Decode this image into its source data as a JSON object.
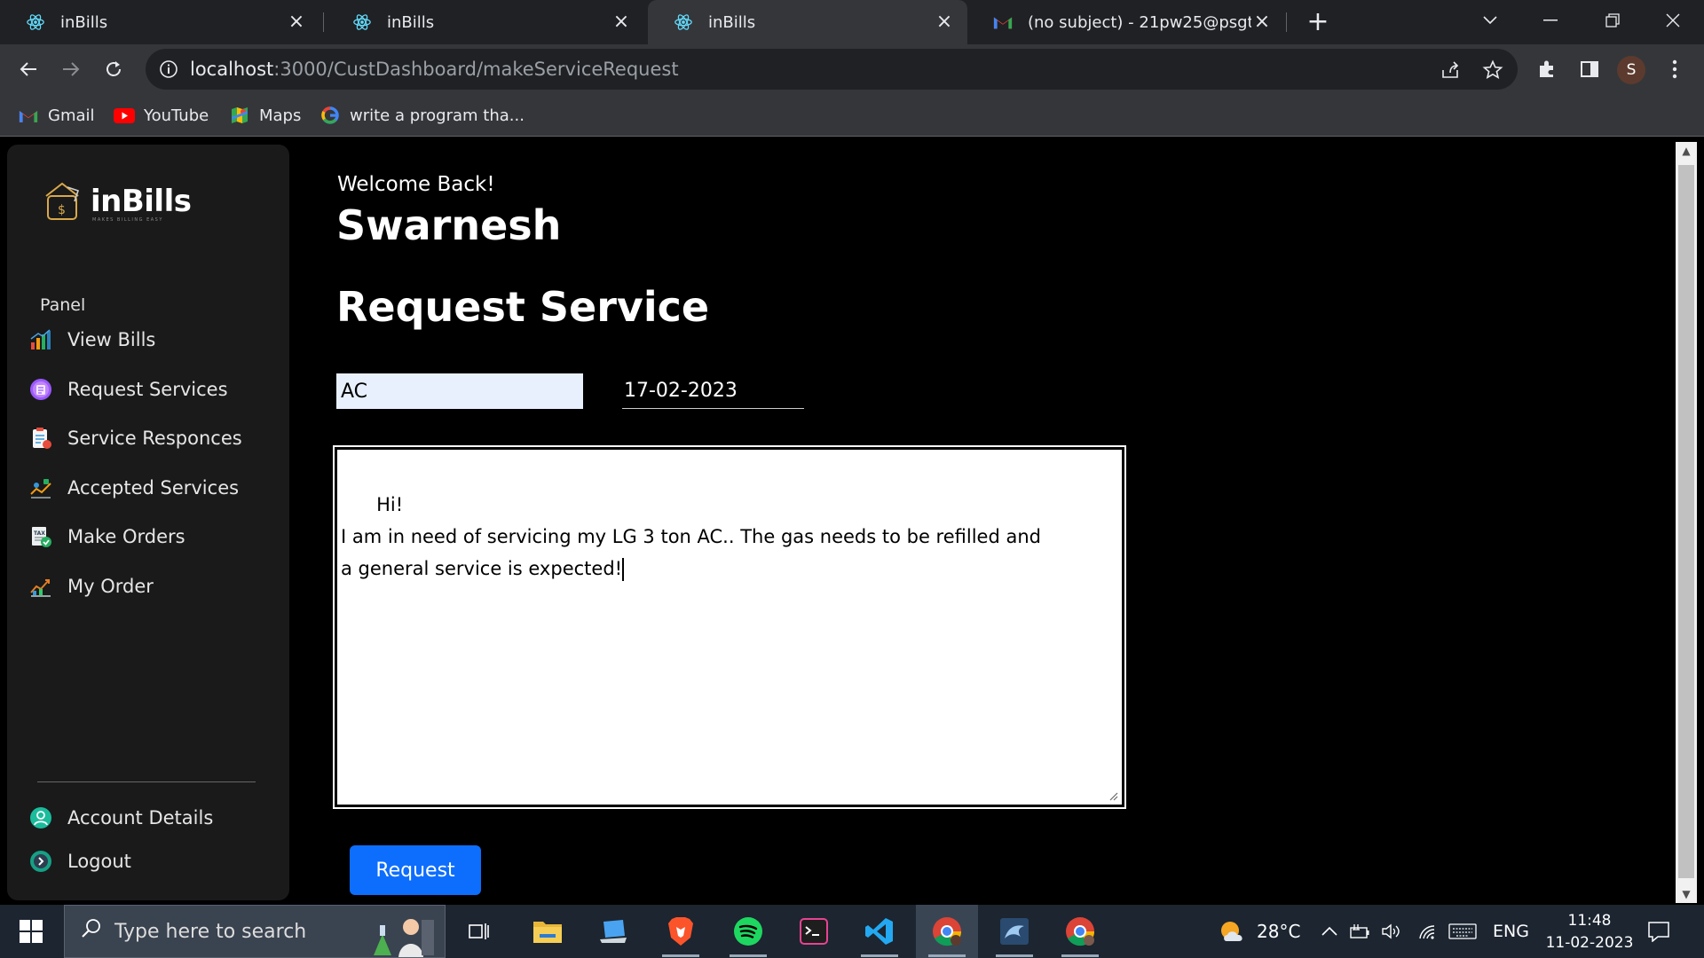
{
  "browser": {
    "tabs": [
      {
        "title": "inBills",
        "active": false
      },
      {
        "title": "inBills",
        "active": false
      },
      {
        "title": "inBills",
        "active": true
      },
      {
        "title": "(no subject) - 21pw25@psgtech.ac.in",
        "active": false
      }
    ],
    "url_host": "localhost",
    "url_path": ":3000/CustDashboard/makeServiceRequest",
    "profile_initial": "S",
    "bookmarks": [
      {
        "label": "Gmail",
        "icon": "gmail-icon"
      },
      {
        "label": "YouTube",
        "icon": "youtube-icon"
      },
      {
        "label": "Maps",
        "icon": "maps-icon"
      },
      {
        "label": "write a program tha...",
        "icon": "google-icon"
      }
    ]
  },
  "sidebar": {
    "brand": "inBills",
    "brand_tagline": "MAKES BILLING EASY",
    "panel_label": "Panel",
    "items": [
      {
        "label": "View Bills",
        "icon": "bar-chart-icon"
      },
      {
        "label": "Request Services",
        "icon": "service-request-icon"
      },
      {
        "label": "Service Responces",
        "icon": "clipboard-icon"
      },
      {
        "label": "Accepted Services",
        "icon": "handshake-icon"
      },
      {
        "label": "Make Orders",
        "icon": "tax-document-icon"
      },
      {
        "label": "My Order",
        "icon": "order-icon"
      }
    ],
    "bottom_items": [
      {
        "label": "Account Details",
        "icon": "user-icon"
      },
      {
        "label": "Logout",
        "icon": "logout-icon"
      }
    ]
  },
  "main": {
    "welcome": "Welcome Back!",
    "user_name": "Swarnesh",
    "title": "Request Service",
    "service_type_value": "AC",
    "date_value": "17-02-2023",
    "description_value": "Hi!\nI am in need of servicing my LG 3 ton AC.. The gas needs to be refilled and\na general service is expected!",
    "request_button": "Request"
  },
  "taskbar": {
    "search_placeholder": "Type here to search",
    "weather": "28°C",
    "language": "ENG",
    "time": "11:48",
    "date": "11-02-2023"
  },
  "colors": {
    "page_background": "#000000",
    "sidebar_background": "#1a1a1a",
    "accent_button": "#0d6efd",
    "autofill_input": "#e8f0fe"
  }
}
